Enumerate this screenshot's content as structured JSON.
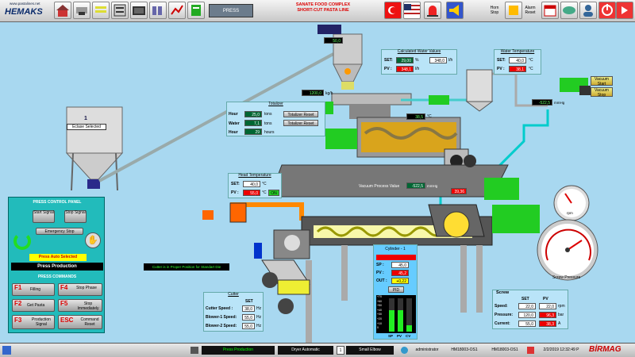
{
  "toolbar": {
    "logo_url": "www.pastalines.net",
    "logo_name": "HEMAKS",
    "press_label": "PRESS",
    "title_line1": "SANATE FOOD COMPLEX",
    "title_line2": "SHORT-CUT PASTA  LINE",
    "horn_label": "Horn Stop",
    "alarm_label": "Alarm Reset"
  },
  "silo": {
    "number": "1",
    "label": "Eclase Selected"
  },
  "doser": {
    "value": "50,0",
    "flow_value": "1200,0",
    "flow_unit": "kg/h"
  },
  "totalizer": {
    "title": "Totalizer",
    "hour_label": "Hour",
    "water_label": "Water",
    "hour_value": "25,0",
    "water_value": "7,1",
    "hour2_value": "29",
    "unit_tons": "tons",
    "unit_hours": "hours",
    "reset_label": "Totalizer Reset",
    "water_reset_label": "Totalizer Reset"
  },
  "water_values": {
    "title": "Calculated Water Values",
    "set_label": "SET:",
    "pv_label": "PV :",
    "set_pct": "29,00",
    "pct_unit": "%",
    "set_lh": "348,0",
    "lh_unit": "l/h",
    "pv_lh": "348,1",
    "pv_unit": "l/h"
  },
  "water_temp": {
    "title": "Water Temperature",
    "set_label": "SET:",
    "pv_label": "PV :",
    "set_value": "40,0",
    "pv_value": "38,1",
    "unit": "°C"
  },
  "mixer": {
    "pv_value": "38,5",
    "unit": "°C"
  },
  "vacuum": {
    "start_label": "Vacuum Start",
    "stop_label": "Vacuum Stop",
    "value": "-522,5",
    "unit": "mmHg",
    "process_label": "Vacuum Process Value",
    "process_value": "-522,5",
    "process_unit": "mmHg"
  },
  "head_temp": {
    "title": "Head Temperature",
    "set_label": "SET:",
    "pv_label": "PV :",
    "set_value": "40,0",
    "pv_value": "55,0",
    "unit": "°C",
    "status": "ON"
  },
  "screw_head_value": "39,36",
  "cutter_msg": "Cutter is in Proper Position for Standart Die",
  "control_panel": {
    "title": "PRESS CONTROL PANEL",
    "start": "Start Signal",
    "stop": "Stop Signal",
    "emergency": "Emergency Stop",
    "auto_selected": "Press Auto Selected",
    "production": "Press Production",
    "commands_title": "PRESS COMMANDS",
    "f1": "F1",
    "f1_label": "Filling",
    "f4": "F4",
    "f4_label": "Stop Phase",
    "f2": "F2",
    "f2_label": "Get Pasta",
    "f5": "F5",
    "f5_label": "Stop Immediately",
    "f3": "F3",
    "f3_label": "Production Signal",
    "esc": "ESC",
    "esc_label": "Command Reset"
  },
  "cutter": {
    "title": "Cutter",
    "col_set": "SET",
    "rows": [
      {
        "label": "Cutter Speed :",
        "value": "38,0",
        "unit": "Hz"
      },
      {
        "label": "Blower-1 Speed:",
        "value": "55,0",
        "unit": "Hz"
      },
      {
        "label": "Blower-2 Speed:",
        "value": "55,0",
        "unit": "Hz"
      }
    ]
  },
  "cylinder": {
    "title": "Cylinder - 1",
    "sp_label": "SP :",
    "sp_value": "45,0",
    "pv_label": "PV :",
    "pv_value": "45,2",
    "out_label": "OUT :",
    "out_value": "+0,22",
    "pid_label": "PID",
    "scale": [
      "+70",
      "+60",
      "+50",
      "+40",
      "+30",
      "+20",
      "+10",
      "0"
    ],
    "bar_labels": [
      "SP",
      "PV",
      "CV"
    ],
    "bar_levels": [
      0.64,
      0.65,
      0.2
    ]
  },
  "screw": {
    "title": "Screw",
    "col_set": "SET",
    "col_pv": "PV",
    "rows": [
      {
        "label": "Speed:",
        "set": "22,0",
        "pv": "22,0",
        "unit": "rpm"
      },
      {
        "label": "Pressure:",
        "set": "120,0",
        "pv": "96,3",
        "unit": "bar"
      },
      {
        "label": "Current:",
        "set": "55,0",
        "pv": "38,3",
        "unit": "A"
      }
    ]
  },
  "gauges": {
    "rpm_label": "rpm",
    "pressure_label": "Screw Pressure"
  },
  "statusbar": {
    "production": "Press Production",
    "mode": "Dryer Automatic",
    "num": "1",
    "product": "Small Elbow",
    "user": "administrator",
    "host1": "HM18003-OS1",
    "host2": "HM18003-OS1",
    "datetime": "2/2/2019 12:32:49 P",
    "brand": "BİRMAG"
  }
}
